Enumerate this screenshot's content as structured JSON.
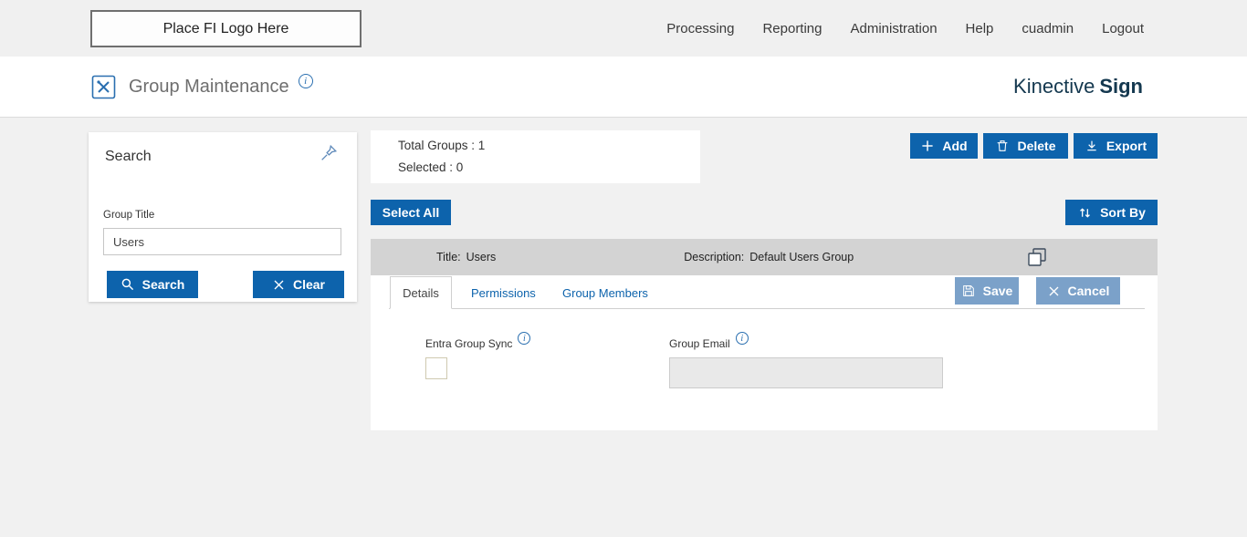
{
  "top_nav": {
    "logo_text": "Place FI Logo Here",
    "items": [
      {
        "label": "Processing"
      },
      {
        "label": "Reporting"
      },
      {
        "label": "Administration"
      },
      {
        "label": "Help"
      },
      {
        "label": "cuadmin"
      },
      {
        "label": "Logout"
      }
    ]
  },
  "header": {
    "title": "Group Maintenance",
    "brand_regular": "Kinective",
    "brand_bold": "Sign"
  },
  "search_panel": {
    "title": "Search",
    "group_title_label": "Group Title",
    "group_title_value": "Users",
    "search_button": "Search",
    "clear_button": "Clear"
  },
  "summary": {
    "total_groups": "Total Groups : 1",
    "selected": "Selected : 0"
  },
  "toolbar": {
    "add": "Add",
    "delete": "Delete",
    "export": "Export",
    "select_all": "Select All",
    "sort_by": "Sort By"
  },
  "group_row": {
    "title_label": "Title:",
    "title_value": "Users",
    "description_label": "Description:",
    "description_value": "Default Users Group"
  },
  "detail": {
    "tabs": [
      {
        "label": "Details"
      },
      {
        "label": "Permissions"
      },
      {
        "label": "Group Members"
      }
    ],
    "save_button": "Save",
    "cancel_button": "Cancel",
    "entra_label": "Entra Group Sync",
    "group_email_label": "Group Email",
    "group_email_value": ""
  },
  "colors": {
    "primary_blue": "#0d63ac",
    "muted_blue": "#7ba1c9",
    "brand_navy": "#14384f",
    "row_gray": "#d3d3d3",
    "content_bg": "#f1f1f1"
  }
}
